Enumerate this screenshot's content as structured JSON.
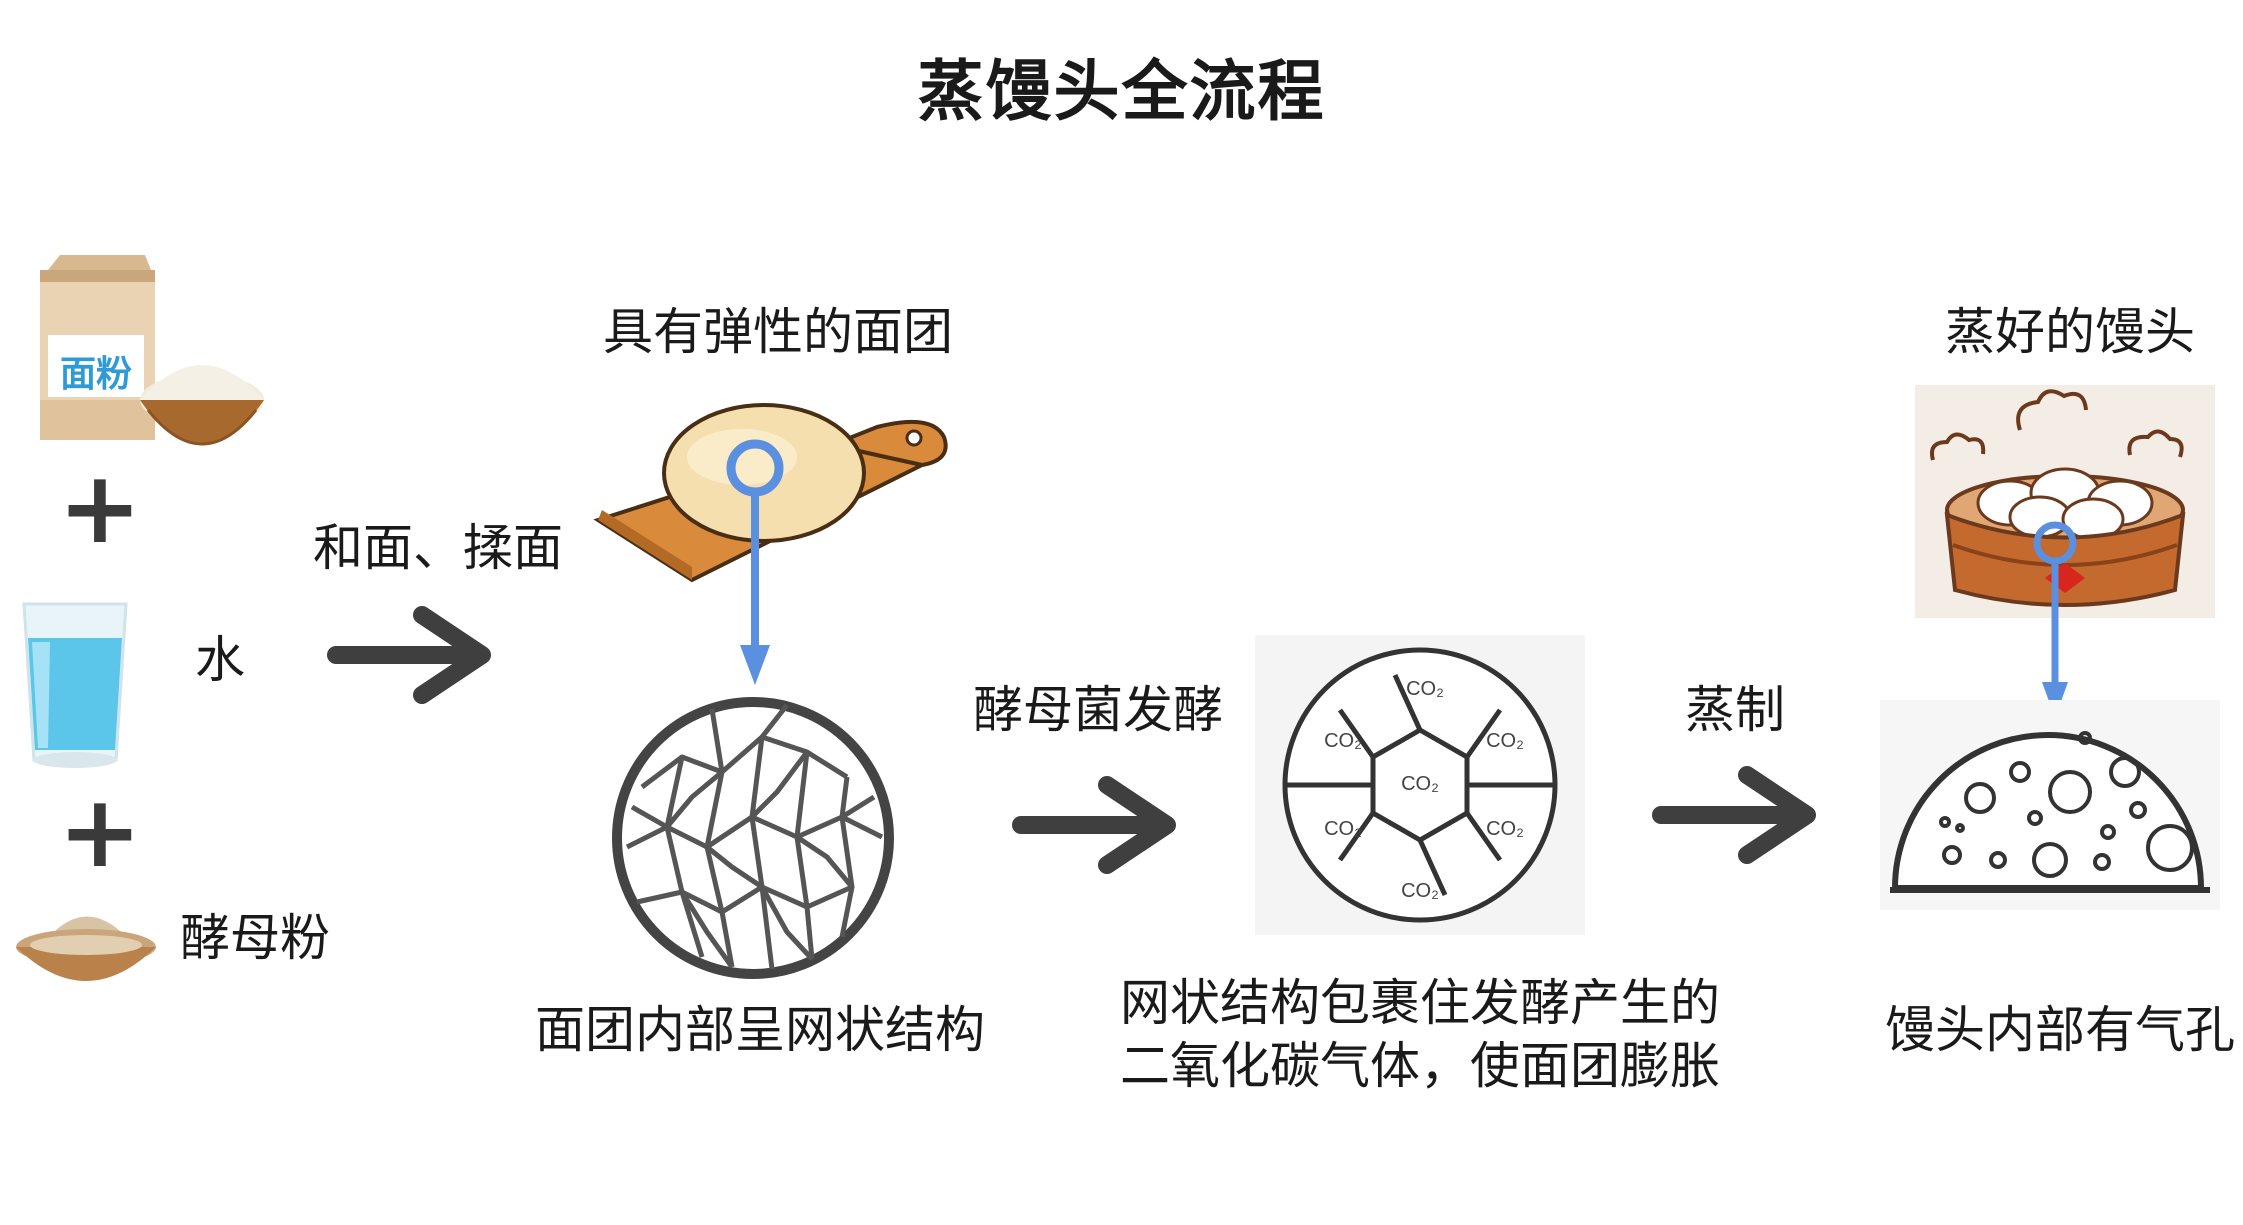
{
  "title": "蒸馒头全流程",
  "ingredients": {
    "flour_bag_text": "面粉",
    "water": "水",
    "yeast": "酵母粉",
    "plus": "+"
  },
  "steps": {
    "knead": "和面、揉面",
    "ferment": "酵母菌发酵",
    "steam": "蒸制"
  },
  "captions": {
    "elastic_dough": "具有弹性的面团",
    "network": "面团内部呈网状结构",
    "gas_line1": "网状结构包裹住发酵产生的",
    "gas_line2": "二氧化碳气体，使面团膨胀",
    "steamed_bun": "蒸好的馒头",
    "pores": "馒头内部有气孔"
  },
  "co2_label": "CO₂",
  "colors": {
    "arrow": "#3f3f3f",
    "pointer": "#5b8fe0",
    "bag_label": "#2e9ad8",
    "steamer": "#c46a2e"
  }
}
